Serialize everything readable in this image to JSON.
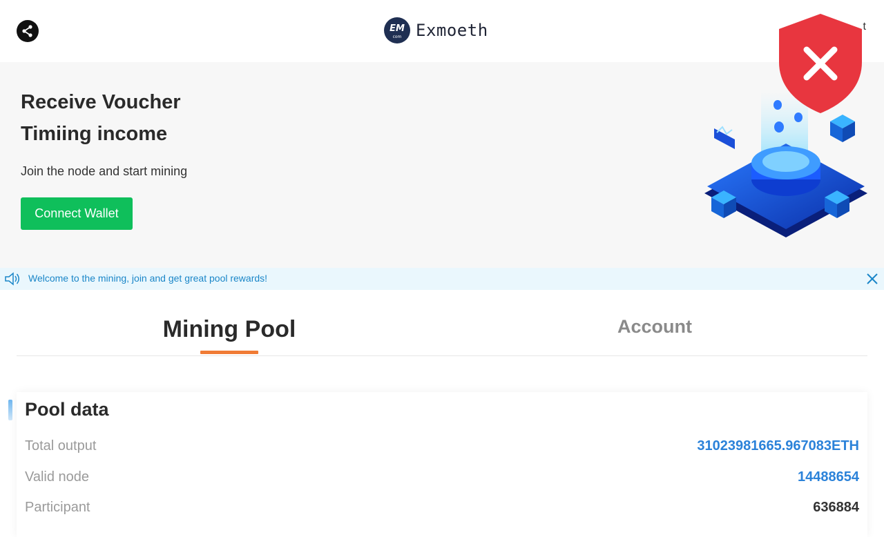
{
  "header": {
    "brand_name": "Exmoeth",
    "brand_logo_text": "EM",
    "brand_logo_sub": "com",
    "right_text": "t"
  },
  "hero": {
    "title_line1": "Receive Voucher",
    "title_line2": "Timiing income",
    "subtitle": "Join the node and start mining",
    "connect_button": "Connect Wallet"
  },
  "notice": {
    "text": "Welcome to the mining, join and get great pool rewards!"
  },
  "tabs": [
    {
      "label": "Mining Pool",
      "active": true
    },
    {
      "label": "Account",
      "active": false
    }
  ],
  "pool": {
    "title": "Pool data",
    "rows": [
      {
        "label": "Total output",
        "value": "31023981665.967083ETH"
      },
      {
        "label": "Valid node",
        "value": "14488654"
      },
      {
        "label": "Participant",
        "value": "636884"
      }
    ]
  },
  "colors": {
    "accent_green": "#0fbf5b",
    "link_blue": "#2b82d9",
    "tab_underline": "#f07b35",
    "badge_red": "#e8363f"
  },
  "icons": [
    "share-icon",
    "speaker-icon",
    "close-icon",
    "shield-x-icon"
  ]
}
